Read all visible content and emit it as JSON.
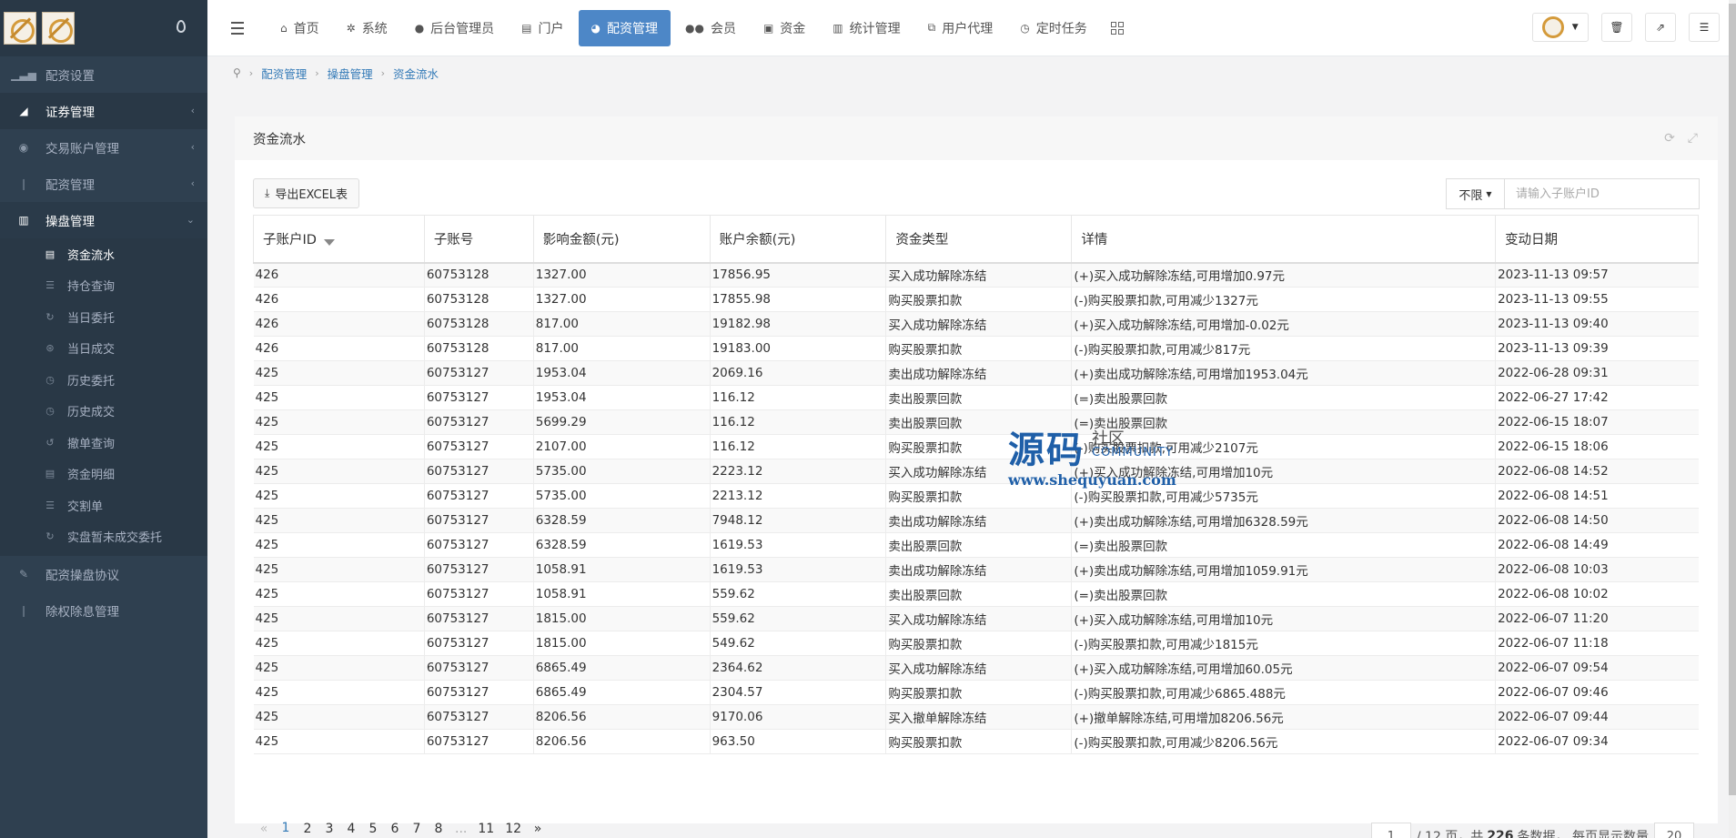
{
  "sidebar": {
    "items": [
      {
        "label": "配资设置",
        "icon": "bar-chart-icon",
        "state": "normal",
        "arrow": ""
      },
      {
        "label": "证券管理",
        "icon": "area-chart-icon",
        "state": "active",
        "arrow": "‹"
      },
      {
        "label": "交易账户管理",
        "icon": "user-circle-icon",
        "state": "normal",
        "arrow": "‹"
      },
      {
        "label": "配资管理",
        "icon": "thermometer-icon",
        "state": "normal",
        "arrow": "‹"
      },
      {
        "label": "操盘管理",
        "icon": "bank-icon",
        "state": "open",
        "arrow": "⌄"
      }
    ],
    "subitems": [
      {
        "label": "资金流水",
        "active": true
      },
      {
        "label": "持仓查询",
        "active": false
      },
      {
        "label": "当日委托",
        "active": false
      },
      {
        "label": "当日成交",
        "active": false
      },
      {
        "label": "历史委托",
        "active": false
      },
      {
        "label": "历史成交",
        "active": false
      },
      {
        "label": "撤单查询",
        "active": false
      },
      {
        "label": "资金明细",
        "active": false
      },
      {
        "label": "交割单",
        "active": false
      },
      {
        "label": "实盘暂未成交委托",
        "active": false
      }
    ],
    "bottom_items": [
      {
        "label": "配资操盘协议",
        "icon": "pencil-icon"
      },
      {
        "label": "除权除息管理",
        "icon": "thermometer-icon"
      }
    ]
  },
  "topnav": {
    "tabs": [
      {
        "label": "首页",
        "icon": "home-icon",
        "glyph": "⌂"
      },
      {
        "label": "系统",
        "icon": "gear-icon",
        "glyph": "✲"
      },
      {
        "label": "后台管理员",
        "icon": "user-icon",
        "glyph": "●"
      },
      {
        "label": "门户",
        "icon": "newspaper-icon",
        "glyph": "▤"
      },
      {
        "label": "配资管理",
        "icon": "pie-chart-icon",
        "glyph": "◕",
        "active": true
      },
      {
        "label": "会员",
        "icon": "users-icon",
        "glyph": "●●"
      },
      {
        "label": "资金",
        "icon": "money-icon",
        "glyph": "▣"
      },
      {
        "label": "统计管理",
        "icon": "bar-chart-icon",
        "glyph": "▥"
      },
      {
        "label": "用户代理",
        "icon": "sitemap-icon",
        "glyph": "⧉"
      },
      {
        "label": "定时任务",
        "icon": "clock-icon",
        "glyph": "◷"
      }
    ]
  },
  "breadcrumb": [
    "配资管理",
    "操盘管理",
    "资金流水"
  ],
  "panel": {
    "title": "资金流水",
    "export_label": "导出EXCEL表",
    "filter_select": "不限",
    "search_placeholder": "请输入子账户ID"
  },
  "table": {
    "columns": [
      "子账户ID",
      "子账号",
      "影响金额(元)",
      "账户余额(元)",
      "资金类型",
      "详情",
      "变动日期"
    ],
    "rows": [
      [
        "426",
        "60753128",
        "1327.00",
        "17856.95",
        "买入成功解除冻结",
        "(+)买入成功解除冻结,可用增加0.97元",
        "2023-11-13 09:57"
      ],
      [
        "426",
        "60753128",
        "1327.00",
        "17855.98",
        "购买股票扣款",
        "(-)购买股票扣款,可用减少1327元",
        "2023-11-13 09:55"
      ],
      [
        "426",
        "60753128",
        "817.00",
        "19182.98",
        "买入成功解除冻结",
        "(+)买入成功解除冻结,可用增加-0.02元",
        "2023-11-13 09:40"
      ],
      [
        "426",
        "60753128",
        "817.00",
        "19183.00",
        "购买股票扣款",
        "(-)购买股票扣款,可用减少817元",
        "2023-11-13 09:39"
      ],
      [
        "425",
        "60753127",
        "1953.04",
        "2069.16",
        "卖出成功解除冻结",
        "(+)卖出成功解除冻结,可用增加1953.04元",
        "2022-06-28 09:31"
      ],
      [
        "425",
        "60753127",
        "1953.04",
        "116.12",
        "卖出股票回款",
        "(=)卖出股票回款",
        "2022-06-27 17:42"
      ],
      [
        "425",
        "60753127",
        "5699.29",
        "116.12",
        "卖出股票回款",
        "(=)卖出股票回款",
        "2022-06-15 18:07"
      ],
      [
        "425",
        "60753127",
        "2107.00",
        "116.12",
        "购买股票扣款",
        "(-)购买股票扣款,可用减少2107元",
        "2022-06-15 18:06"
      ],
      [
        "425",
        "60753127",
        "5735.00",
        "2223.12",
        "买入成功解除冻结",
        "(+)买入成功解除冻结,可用增加10元",
        "2022-06-08 14:52"
      ],
      [
        "425",
        "60753127",
        "5735.00",
        "2213.12",
        "购买股票扣款",
        "(-)购买股票扣款,可用减少5735元",
        "2022-06-08 14:51"
      ],
      [
        "425",
        "60753127",
        "6328.59",
        "7948.12",
        "卖出成功解除冻结",
        "(+)卖出成功解除冻结,可用增加6328.59元",
        "2022-06-08 14:50"
      ],
      [
        "425",
        "60753127",
        "6328.59",
        "1619.53",
        "卖出股票回款",
        "(=)卖出股票回款",
        "2022-06-08 14:49"
      ],
      [
        "425",
        "60753127",
        "1058.91",
        "1619.53",
        "卖出成功解除冻结",
        "(+)卖出成功解除冻结,可用增加1059.91元",
        "2022-06-08 10:03"
      ],
      [
        "425",
        "60753127",
        "1058.91",
        "559.62",
        "卖出股票回款",
        "(=)卖出股票回款",
        "2022-06-08 10:02"
      ],
      [
        "425",
        "60753127",
        "1815.00",
        "559.62",
        "买入成功解除冻结",
        "(+)买入成功解除冻结,可用增加10元",
        "2022-06-07 11:20"
      ],
      [
        "425",
        "60753127",
        "1815.00",
        "549.62",
        "购买股票扣款",
        "(-)购买股票扣款,可用减少1815元",
        "2022-06-07 11:18"
      ],
      [
        "425",
        "60753127",
        "6865.49",
        "2364.62",
        "买入成功解除冻结",
        "(+)买入成功解除冻结,可用增加60.05元",
        "2022-06-07 09:54"
      ],
      [
        "425",
        "60753127",
        "6865.49",
        "2304.57",
        "购买股票扣款",
        "(-)购买股票扣款,可用减少6865.488元",
        "2022-06-07 09:46"
      ],
      [
        "425",
        "60753127",
        "8206.56",
        "9170.06",
        "买入撤单解除冻结",
        "(+)撤单解除冻结,可用增加8206.56元",
        "2022-06-07 09:44"
      ],
      [
        "425",
        "60753127",
        "8206.56",
        "963.50",
        "购买股票扣款",
        "(-)购买股票扣款,可用减少8206.56元",
        "2022-06-07 09:34"
      ]
    ]
  },
  "pagination": {
    "prev": "«",
    "pages": [
      "1",
      "2",
      "3",
      "4",
      "5",
      "6",
      "7",
      "8",
      "...",
      "11",
      "12"
    ],
    "current": "1",
    "next": "»",
    "current_input": "1",
    "total_pages_text": "/ 12 页，共",
    "total_count": "226",
    "count_suffix": "条数据，  每页显示数量",
    "page_size": "20"
  },
  "watermark": {
    "big": "源码",
    "small": "社区",
    "community": "COMMUNITY",
    "url": "www.shequyuan.com"
  },
  "colors": {
    "sidebar_bg": "#2f4050",
    "accent": "#4d87c7",
    "link": "#337ab7"
  }
}
